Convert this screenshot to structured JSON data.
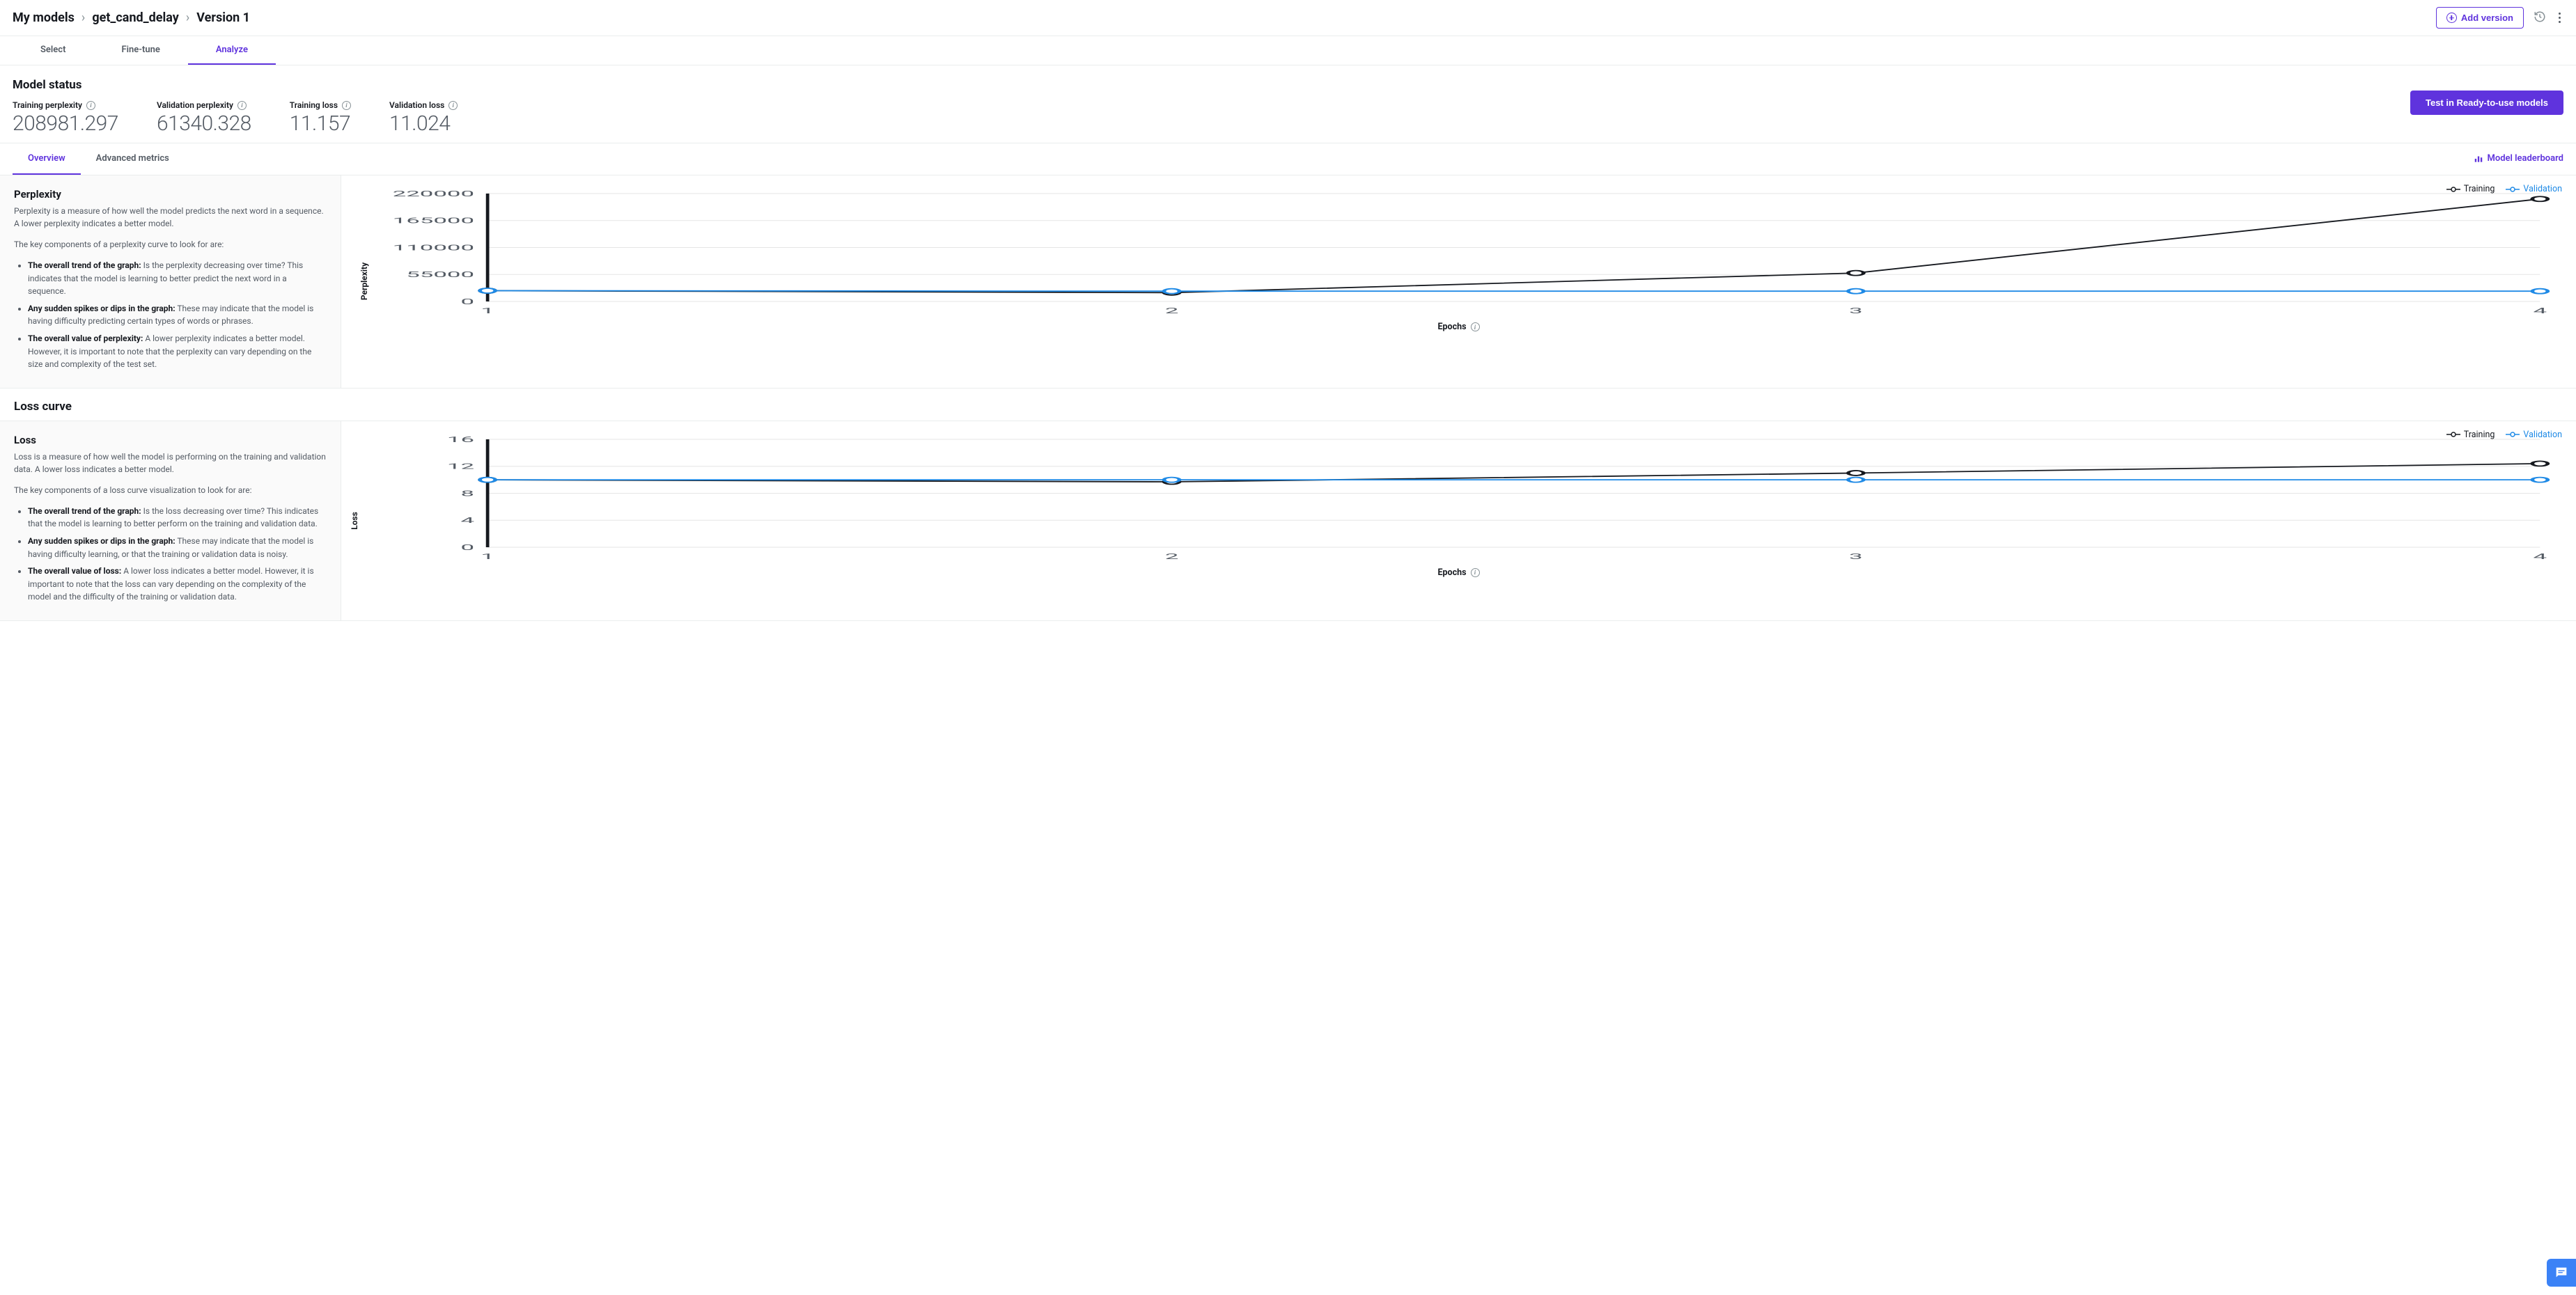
{
  "breadcrumb": {
    "root": "My models",
    "project": "get_cand_delay",
    "version": "Version 1"
  },
  "top_actions": {
    "add_version": "Add version"
  },
  "tabs": {
    "select": "Select",
    "finetune": "Fine-tune",
    "analyze": "Analyze"
  },
  "status": {
    "title": "Model status",
    "metrics": {
      "train_ppl_label": "Training perplexity",
      "train_ppl_value": "208981.297",
      "val_ppl_label": "Validation perplexity",
      "val_ppl_value": "61340.328",
      "train_loss_label": "Training loss",
      "train_loss_value": "11.157",
      "val_loss_label": "Validation loss",
      "val_loss_value": "11.024"
    },
    "test_button": "Test in Ready-to-use models"
  },
  "subtabs": {
    "overview": "Overview",
    "advanced": "Advanced metrics",
    "leaderboard": "Model leaderboard"
  },
  "perplexity_desc": {
    "heading": "Perplexity",
    "intro": "Perplexity is a measure of how well the model predicts the next word in a sequence. A lower perplexity indicates a better model.",
    "key_line": "The key components of a perplexity curve to look for are:",
    "b1_bold": "The overall trend of the graph:",
    "b1_rest": " Is the perplexity decreasing over time? This indicates that the model is learning to better predict the next word in a sequence.",
    "b2_bold": "Any sudden spikes or dips in the graph:",
    "b2_rest": " These may indicate that the model is having difficulty predicting certain types of words or phrases.",
    "b3_bold": "The overall value of perplexity:",
    "b3_rest": " A lower perplexity indicates a better model. However, it is important to note that the perplexity can vary depending on the size and complexity of the test set."
  },
  "loss_header": "Loss curve",
  "loss_desc": {
    "heading": "Loss",
    "intro": "Loss is a measure of how well the model is performing on the training and validation data. A lower loss indicates a better model.",
    "key_line": "The key components of a loss curve visualization to look for are:",
    "b1_bold": "The overall trend of the graph:",
    "b1_rest": " Is the loss decreasing over time? This indicates that the model is learning to better perform on the training and validation data.",
    "b2_bold": "Any sudden spikes or dips in the graph:",
    "b2_rest": " These may indicate that the model is having difficulty learning, or that the training or validation data is noisy.",
    "b3_bold": "The overall value of loss:",
    "b3_rest": " A lower loss indicates a better model. However, it is important to note that the loss can vary depending on the complexity of the model and the difficulty of the training or validation data."
  },
  "legend": {
    "training": "Training",
    "validation": "Validation"
  },
  "axis": {
    "epochs": "Epochs",
    "perplexity": "Perplexity",
    "loss": "Loss"
  },
  "chart_data": [
    {
      "type": "line",
      "title": "Perplexity",
      "xlabel": "Epochs",
      "ylabel": "Perplexity",
      "x": [
        1,
        2,
        3,
        4
      ],
      "ylim": [
        0,
        220000
      ],
      "yticks": [
        0,
        55000,
        110000,
        165000,
        220000
      ],
      "series": [
        {
          "name": "Training",
          "values": [
            22000,
            18000,
            58000,
            208981
          ]
        },
        {
          "name": "Validation",
          "values": [
            22000,
            21000,
            21000,
            21000
          ]
        }
      ]
    },
    {
      "type": "line",
      "title": "Loss",
      "xlabel": "Epochs",
      "ylabel": "Loss",
      "x": [
        1,
        2,
        3,
        4
      ],
      "ylim": [
        0,
        16
      ],
      "yticks": [
        0,
        4,
        8,
        12,
        16
      ],
      "series": [
        {
          "name": "Training",
          "values": [
            10.0,
            9.7,
            11.0,
            12.4
          ]
        },
        {
          "name": "Validation",
          "values": [
            10.0,
            10.0,
            10.0,
            10.0
          ]
        }
      ]
    }
  ],
  "colors": {
    "primary": "#5f33dd",
    "training": "#16191f",
    "validation": "#1f8ae6"
  }
}
